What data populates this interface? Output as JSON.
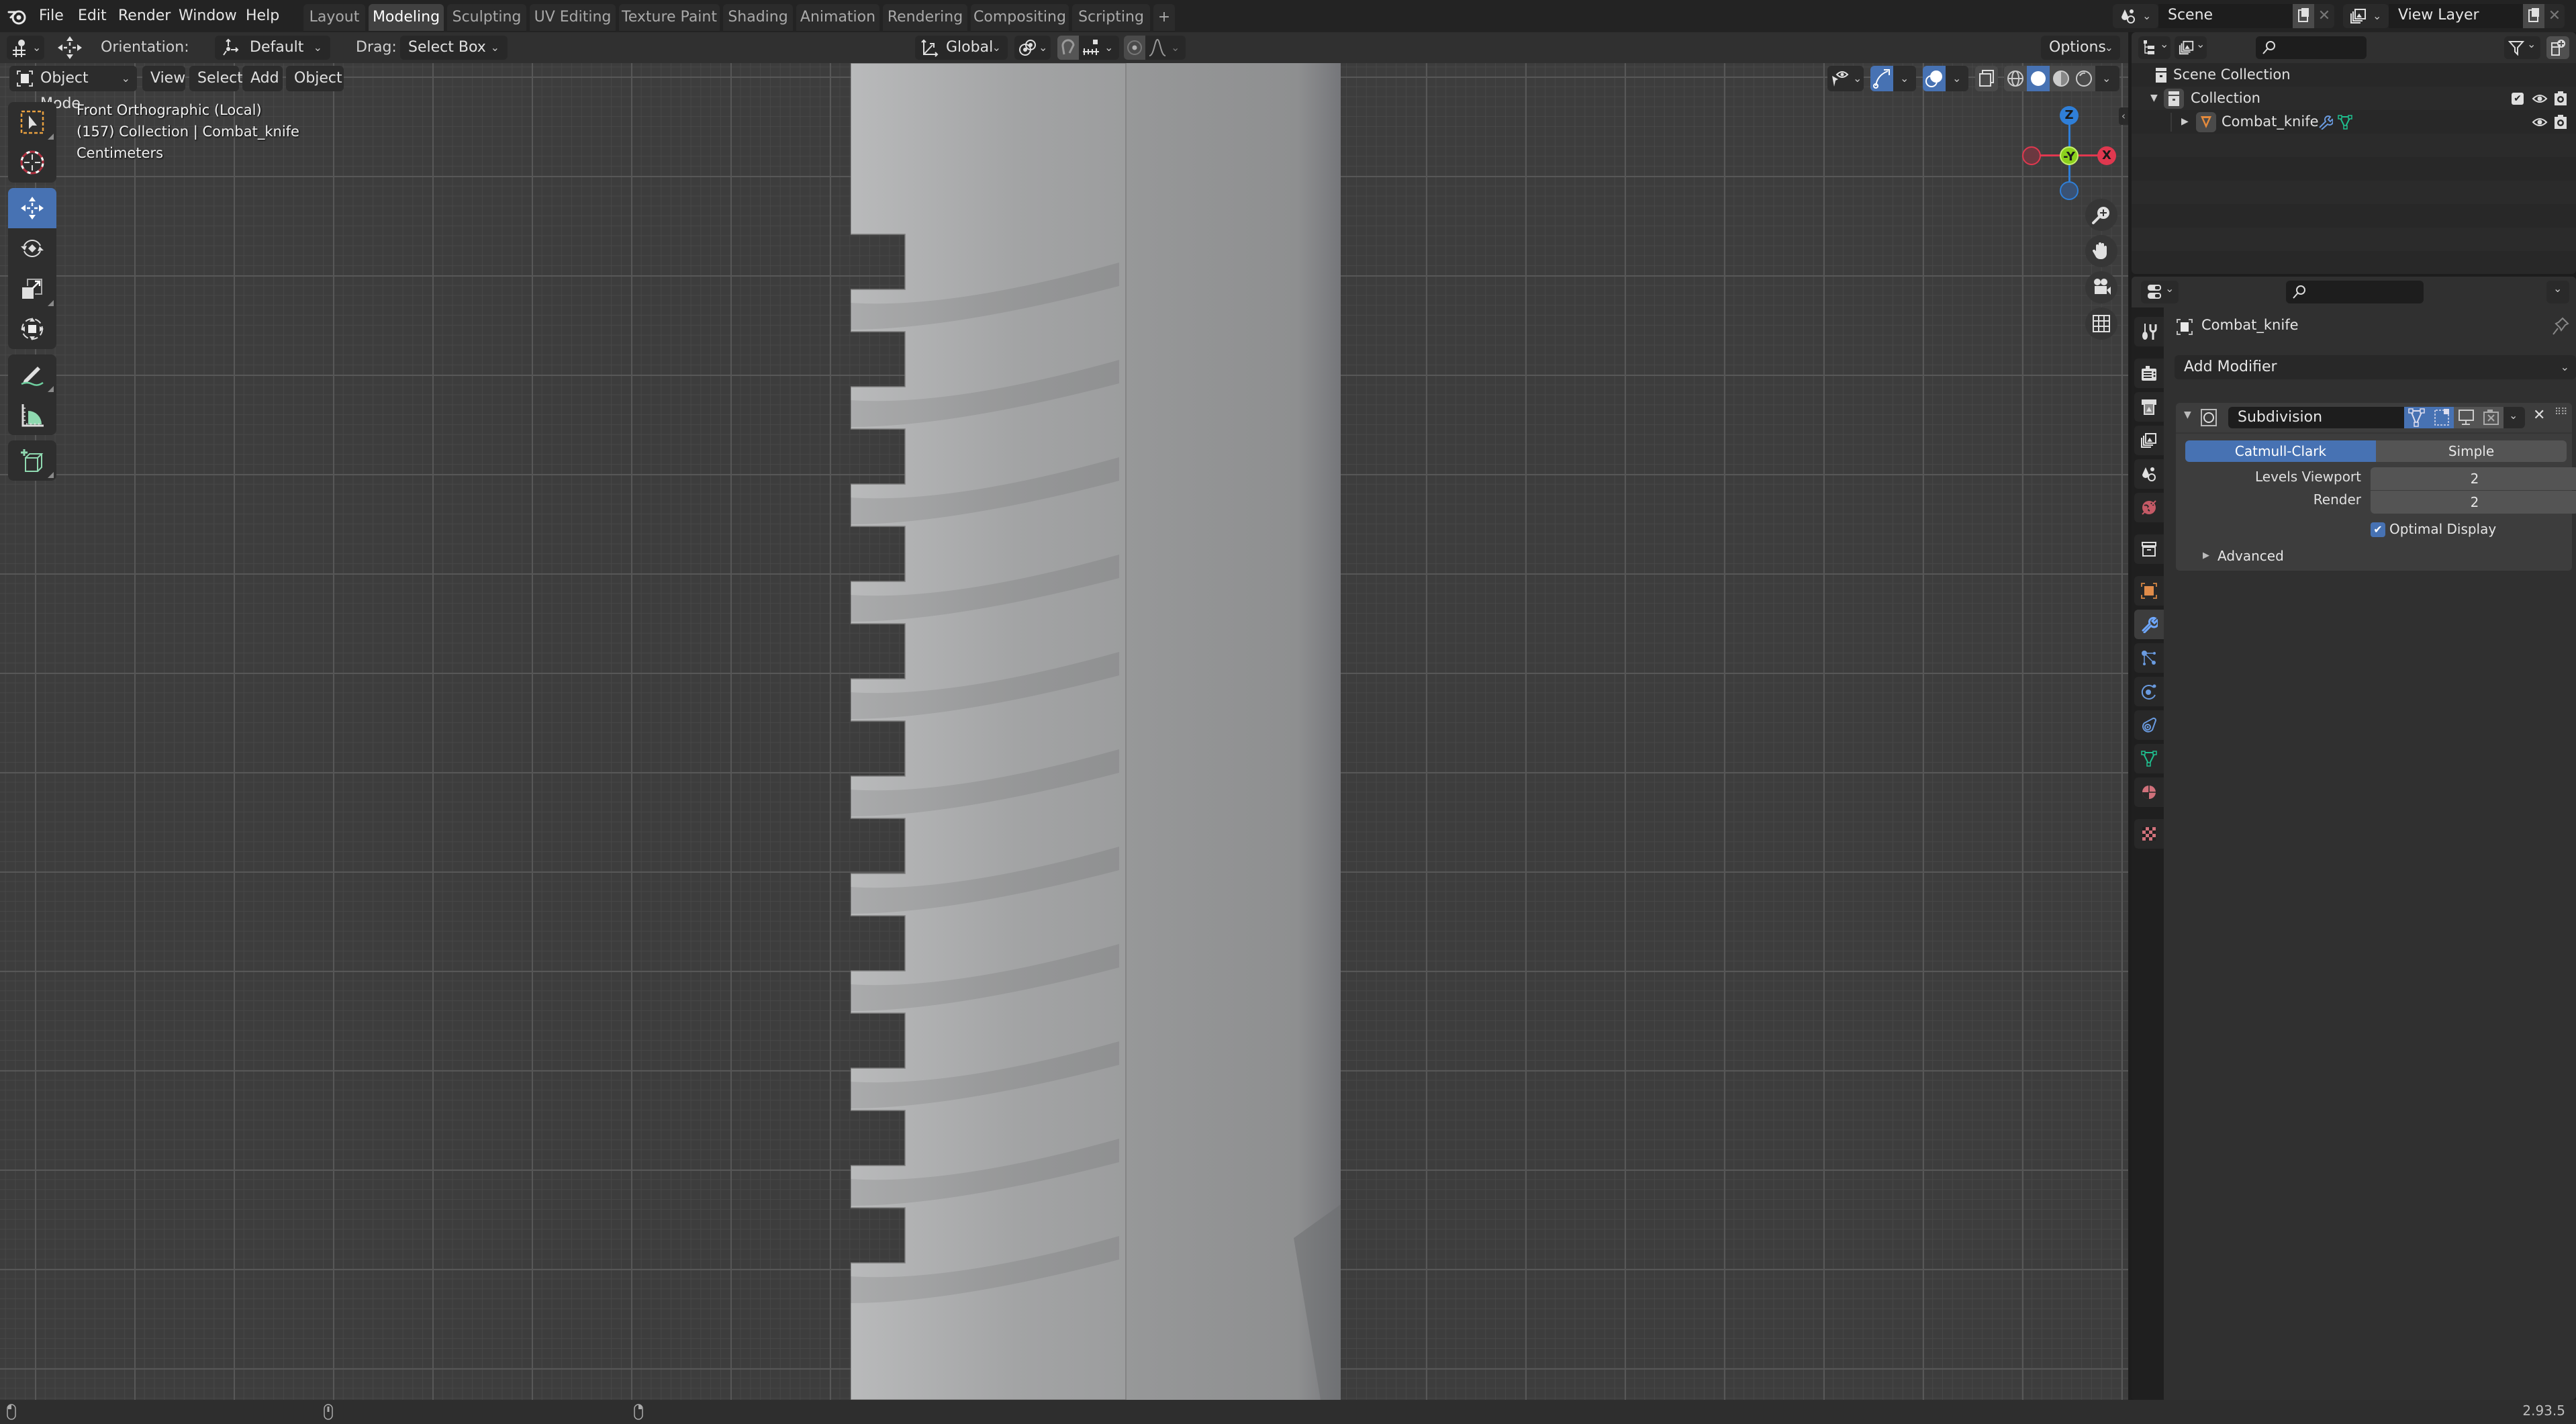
{
  "topbar": {
    "menus": [
      "File",
      "Edit",
      "Render",
      "Window",
      "Help"
    ],
    "workspaces": [
      "Layout",
      "Modeling",
      "Sculpting",
      "UV Editing",
      "Texture Paint",
      "Shading",
      "Animation",
      "Rendering",
      "Compositing",
      "Scripting"
    ],
    "active_workspace": "Modeling",
    "add_workspace": "+",
    "scene": "Scene",
    "view_layer": "View Layer"
  },
  "tool_header": {
    "orientation_label": "Orientation:",
    "orientation_value": "Default",
    "drag_label": "Drag:",
    "drag_value": "Select Box",
    "transform_orientation": "Global",
    "options": "Options"
  },
  "viewport_header": {
    "mode": "Object Mode",
    "menus": [
      "View",
      "Select",
      "Add",
      "Object"
    ]
  },
  "viewport": {
    "view_name": "Front Orthographic (Local)",
    "collection_info": "(157) Collection | Combat_knife",
    "units": "Centimeters",
    "gizmo": {
      "z": "Z",
      "y": "-Y",
      "x": "X"
    },
    "active_tool": "move",
    "tools": [
      "select-box",
      "cursor",
      "move",
      "rotate",
      "scale",
      "transform",
      "annotate",
      "measure",
      "add-cube"
    ],
    "shading_mode": "solid"
  },
  "outliner": {
    "items": [
      {
        "name": "Scene Collection",
        "level": 0
      },
      {
        "name": "Collection",
        "level": 1,
        "expanded": true
      },
      {
        "name": "Combat_knife",
        "level": 2,
        "expanded": false
      }
    ]
  },
  "properties": {
    "object_name": "Combat_knife",
    "add_modifier": "Add Modifier",
    "modifier": {
      "name": "Subdivision",
      "types": [
        "Catmull-Clark",
        "Simple"
      ],
      "active_type": "Catmull-Clark",
      "levels_viewport_label": "Levels Viewport",
      "levels_viewport": "2",
      "render_label": "Render",
      "render": "2",
      "optimal_display_label": "Optimal Display",
      "optimal_display": true,
      "advanced": "Advanced"
    },
    "active_tab": "modifiers"
  },
  "statusbar": {
    "version": "2.93.5"
  },
  "colors": {
    "accent": "#4772b3",
    "axis_x": "#e0384f",
    "axis_y": "#8bd01c",
    "axis_z": "#2f7fd8"
  }
}
